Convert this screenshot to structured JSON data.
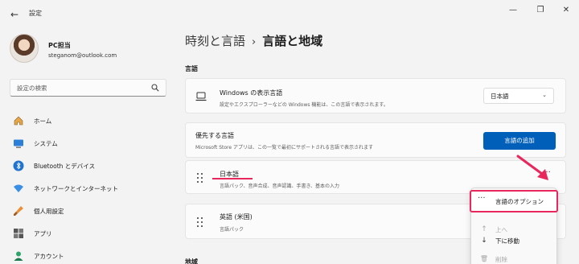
{
  "window": {
    "title": "設定",
    "controls": {
      "minimize": "—",
      "maximize": "❐",
      "close": "✕"
    }
  },
  "profile": {
    "name": "PC担当",
    "email": "steganom@outlook.com"
  },
  "search": {
    "placeholder": "設定の検索"
  },
  "nav": [
    {
      "label": "ホーム",
      "icon": "home-icon"
    },
    {
      "label": "システム",
      "icon": "monitor-icon"
    },
    {
      "label": "Bluetooth とデバイス",
      "icon": "bluetooth-icon"
    },
    {
      "label": "ネットワークとインターネット",
      "icon": "wifi-icon"
    },
    {
      "label": "個人用設定",
      "icon": "brush-icon"
    },
    {
      "label": "アプリ",
      "icon": "apps-icon"
    },
    {
      "label": "アカウント",
      "icon": "account-icon"
    }
  ],
  "breadcrumb": {
    "parent": "時刻と言語",
    "separator": "›",
    "current": "言語と地域"
  },
  "language_section": {
    "heading": "言語"
  },
  "display_language": {
    "title": "Windows の表示言語",
    "subtitle": "設定やエクスプローラーなどの Windows 機能は、この言語で表示されます。",
    "value": "日本語",
    "chevron": "⌄"
  },
  "preferred_languages": {
    "title": "優先する言語",
    "subtitle": "Microsoft Store アプリは、この一覧で最初にサポートされる言語で表示されます",
    "add_button": "言語の追加"
  },
  "languages": [
    {
      "name": "日本語",
      "features": "言語パック、音声合成、音声認識、手書き、基本の入力"
    },
    {
      "name": "英語 (米国)",
      "features": "言語パック"
    }
  ],
  "more_button": "···",
  "context_menu": [
    {
      "icon": "···",
      "label": "言語のオプション",
      "enabled": true
    },
    {
      "icon": "↑",
      "label": "上へ",
      "enabled": false
    },
    {
      "icon": "↓",
      "label": "下に移動",
      "enabled": true
    },
    {
      "icon": "🗑",
      "label": "削除",
      "enabled": false
    }
  ],
  "region_section": {
    "heading": "地域"
  },
  "colors": {
    "accent": "#005fb8",
    "annotation": "#e8275d"
  }
}
